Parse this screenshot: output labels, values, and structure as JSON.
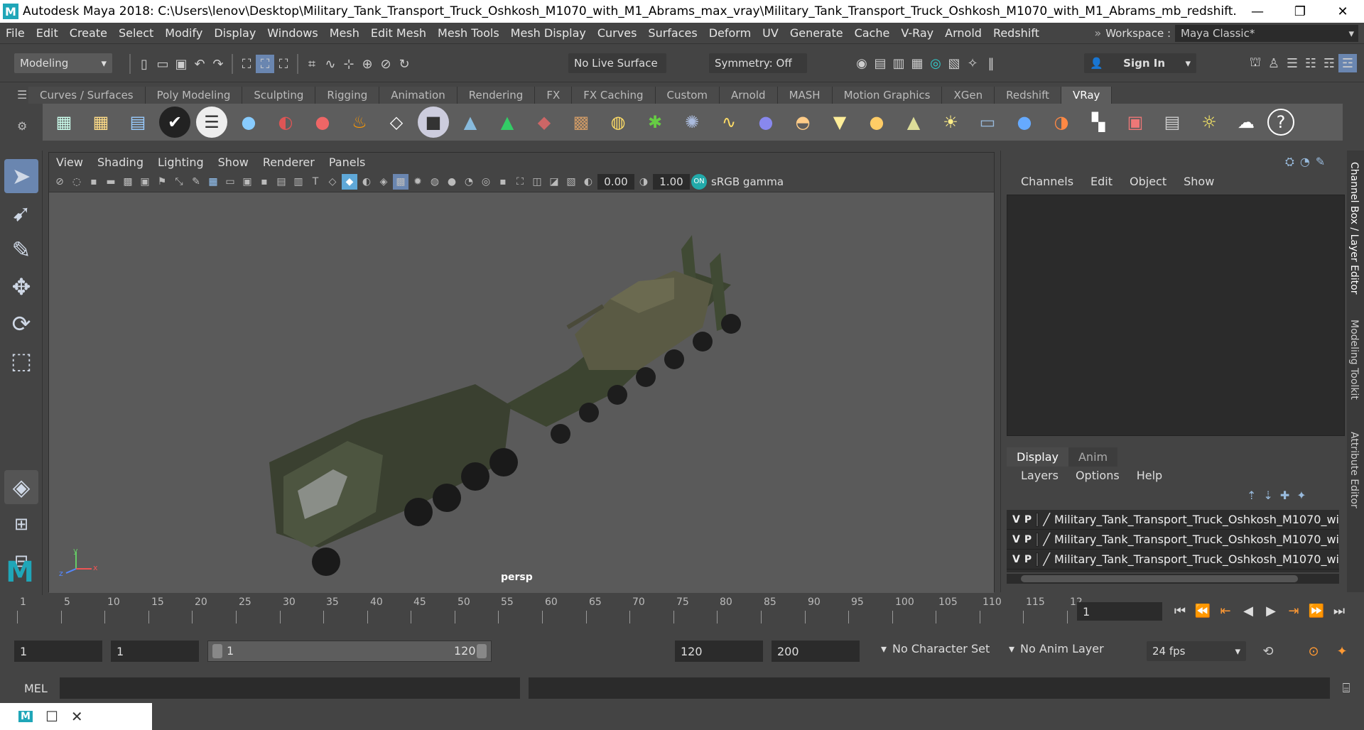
{
  "window": {
    "title": "Autodesk Maya 2018: C:\\Users\\lenov\\Desktop\\Military_Tank_Transport_Truck_Oshkosh_M1070_with_M1_Abrams_max_vray\\Military_Tank_Transport_Truck_Oshkosh_M1070_with_M1_Abrams_mb_redshift.mb",
    "logo": "M"
  },
  "menubar": {
    "items": [
      "File",
      "Edit",
      "Create",
      "Select",
      "Modify",
      "Display",
      "Windows",
      "Mesh",
      "Edit Mesh",
      "Mesh Tools",
      "Mesh Display",
      "Curves",
      "Surfaces",
      "Deform",
      "UV",
      "Generate",
      "Cache",
      "V-Ray",
      "Arnold",
      "Redshift"
    ],
    "workspace_label": "Workspace :",
    "workspace_value": "Maya Classic*"
  },
  "statusline": {
    "mode": "Modeling",
    "live_surface": "No Live Surface",
    "symmetry": "Symmetry: Off",
    "sign_in": "Sign In"
  },
  "shelf": {
    "tabs": [
      "Curves / Surfaces",
      "Poly Modeling",
      "Sculpting",
      "Rigging",
      "Animation",
      "Rendering",
      "FX",
      "FX Caching",
      "Custom",
      "Arnold",
      "MASH",
      "Motion Graphics",
      "XGen",
      "Redshift",
      "VRay"
    ],
    "active_tab": "VRay",
    "icon_count": 33
  },
  "viewport": {
    "menu": [
      "View",
      "Shading",
      "Lighting",
      "Show",
      "Renderer",
      "Panels"
    ],
    "exposure": "0.00",
    "gamma": "1.00",
    "color_space": "sRGB gamma",
    "camera_label": "persp",
    "axis_labels": {
      "x": "x",
      "y": "y",
      "z": "z"
    }
  },
  "channelbox": {
    "menu": [
      "Channels",
      "Edit",
      "Object",
      "Show"
    ],
    "layer_tabs": [
      "Display",
      "Anim"
    ],
    "active_layer_tab": "Display",
    "layer_menu": [
      "Layers",
      "Options",
      "Help"
    ],
    "layers": [
      {
        "v": "V",
        "p": "P",
        "name": "Military_Tank_Transport_Truck_Oshkosh_M1070_wi"
      },
      {
        "v": "V",
        "p": "P",
        "name": "Military_Tank_Transport_Truck_Oshkosh_M1070_wi"
      },
      {
        "v": "V",
        "p": "P",
        "name": "Military_Tank_Transport_Truck_Oshkosh_M1070_wi"
      }
    ]
  },
  "side_tabs": [
    "Channel Box / Layer Editor",
    "Modeling Toolkit",
    "Attribute Editor"
  ],
  "timeslider": {
    "ticks": [
      "1",
      "5",
      "10",
      "15",
      "20",
      "25",
      "30",
      "35",
      "40",
      "45",
      "50",
      "55",
      "60",
      "65",
      "70",
      "75",
      "80",
      "85",
      "90",
      "95",
      "100",
      "105",
      "110",
      "115",
      "12"
    ],
    "current_frame": "1"
  },
  "rangeslider": {
    "start": "1",
    "anim_start": "1",
    "range_start": "1",
    "range_end": "120",
    "anim_end": "120",
    "end": "200",
    "character_set": "No Character Set",
    "anim_layer": "No Anim Layer",
    "fps": "24 fps"
  },
  "cmdline": {
    "label": "MEL"
  }
}
